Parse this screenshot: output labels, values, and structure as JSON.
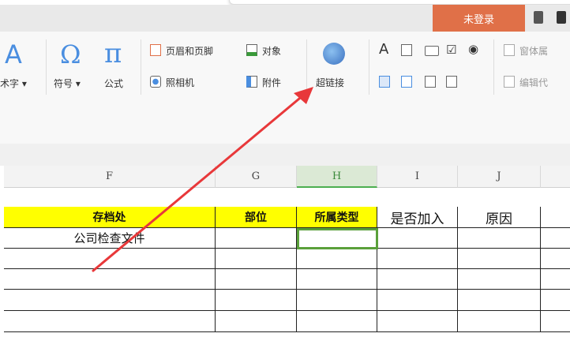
{
  "titlebar": {
    "login_label": "未登录"
  },
  "ribbon": {
    "art_text_label": "术字",
    "symbol_label": "符号",
    "formula_label": "公式",
    "header_footer_label": "页眉和页脚",
    "object_label": "对象",
    "camera_label": "照相机",
    "attachment_label": "附件",
    "hyperlink_label": "超链接",
    "form_label": "窗体属",
    "edit_code_label": "编辑代"
  },
  "sheet": {
    "columns": [
      "F",
      "G",
      "H",
      "I",
      "J"
    ],
    "selected_column": "H",
    "header_row": [
      "存档处",
      "部位",
      "所属类型",
      "是否加入",
      "原因"
    ],
    "rows": [
      [
        "公司检查文件",
        "",
        "",
        "",
        ""
      ],
      [
        "",
        "",
        "",
        "",
        ""
      ],
      [
        "",
        "",
        "",
        "",
        ""
      ],
      [
        "",
        "",
        "",
        "",
        ""
      ],
      [
        "",
        "",
        "",
        "",
        ""
      ]
    ]
  },
  "colors": {
    "accent": "#e07048",
    "header_fill": "#ffff00",
    "selection": "#5aa03a",
    "arrow": "#e8383a"
  }
}
